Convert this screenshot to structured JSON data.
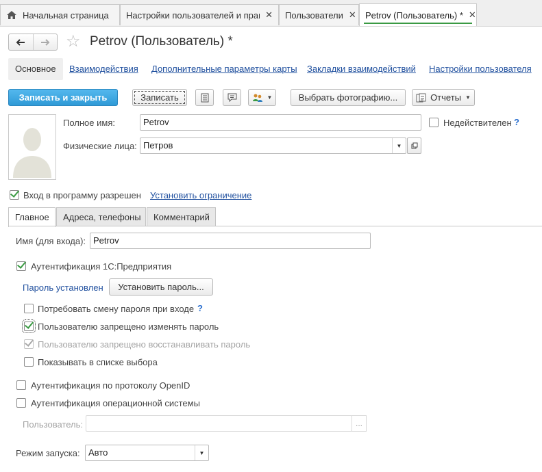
{
  "window_tabs": [
    {
      "label": "Начальная страница",
      "closable": false,
      "active": false,
      "icon": "home-icon"
    },
    {
      "label": "Настройки пользователей и прав",
      "closable": true,
      "active": false
    },
    {
      "label": "Пользователи",
      "closable": true,
      "active": false
    },
    {
      "label": "Petrov (Пользователь) *",
      "closable": true,
      "active": true
    }
  ],
  "close_glyph": "✕",
  "header": {
    "title": "Petrov (Пользователь) *"
  },
  "sections": {
    "main": "Основное",
    "interactions": "Взаимодействия",
    "extra_params": "Дополнительные параметры карты",
    "bookmarks": "Закладки взаимодействий",
    "user_settings": "Настройки пользователя"
  },
  "commands": {
    "save_close": "Записать и закрыть",
    "save": "Записать",
    "choose_photo": "Выбрать фотографию...",
    "reports": "Отчеты"
  },
  "form": {
    "full_name_label": "Полное имя:",
    "full_name_value": "Petrov",
    "inactive_label": "Недействителен",
    "person_label": "Физические лица:",
    "person_value": "Петров",
    "login_allowed_label": "Вход в программу разрешен",
    "set_restriction_link": "Установить ограничение"
  },
  "form_tabs": [
    "Главное",
    "Адреса, телефоны",
    "Комментарий"
  ],
  "main_tab": {
    "login_name_label": "Имя (для входа):",
    "login_name_value": "Petrov",
    "auth_1c_label": "Аутентификация 1С:Предприятия",
    "password_set_text": "Пароль установлен",
    "set_password_button": "Установить пароль...",
    "require_change_label": "Потребовать смену пароля при входе",
    "forbid_change_label": "Пользователю запрещено изменять пароль",
    "forbid_restore_label": "Пользователю запрещено восстанавливать пароль",
    "show_in_list_label": "Показывать в списке выбора",
    "openid_label": "Аутентификация по протоколу OpenID",
    "os_auth_label": "Аутентификация операционной системы",
    "os_user_label": "Пользователь:",
    "os_user_value": "",
    "ellipsis": "...",
    "run_mode_label": "Режим запуска:",
    "run_mode_value": "Авто"
  },
  "question_mark": "?",
  "checkbox_states": {
    "inactive": false,
    "login_allowed": true,
    "auth_1c": true,
    "require_change": false,
    "forbid_change": true,
    "forbid_restore": true,
    "show_in_list": false,
    "openid": false,
    "os_auth": false
  },
  "colors": {
    "accent_green": "#3a9a43",
    "primary_button": "#3ba5e0",
    "link": "#1f4f9e"
  }
}
